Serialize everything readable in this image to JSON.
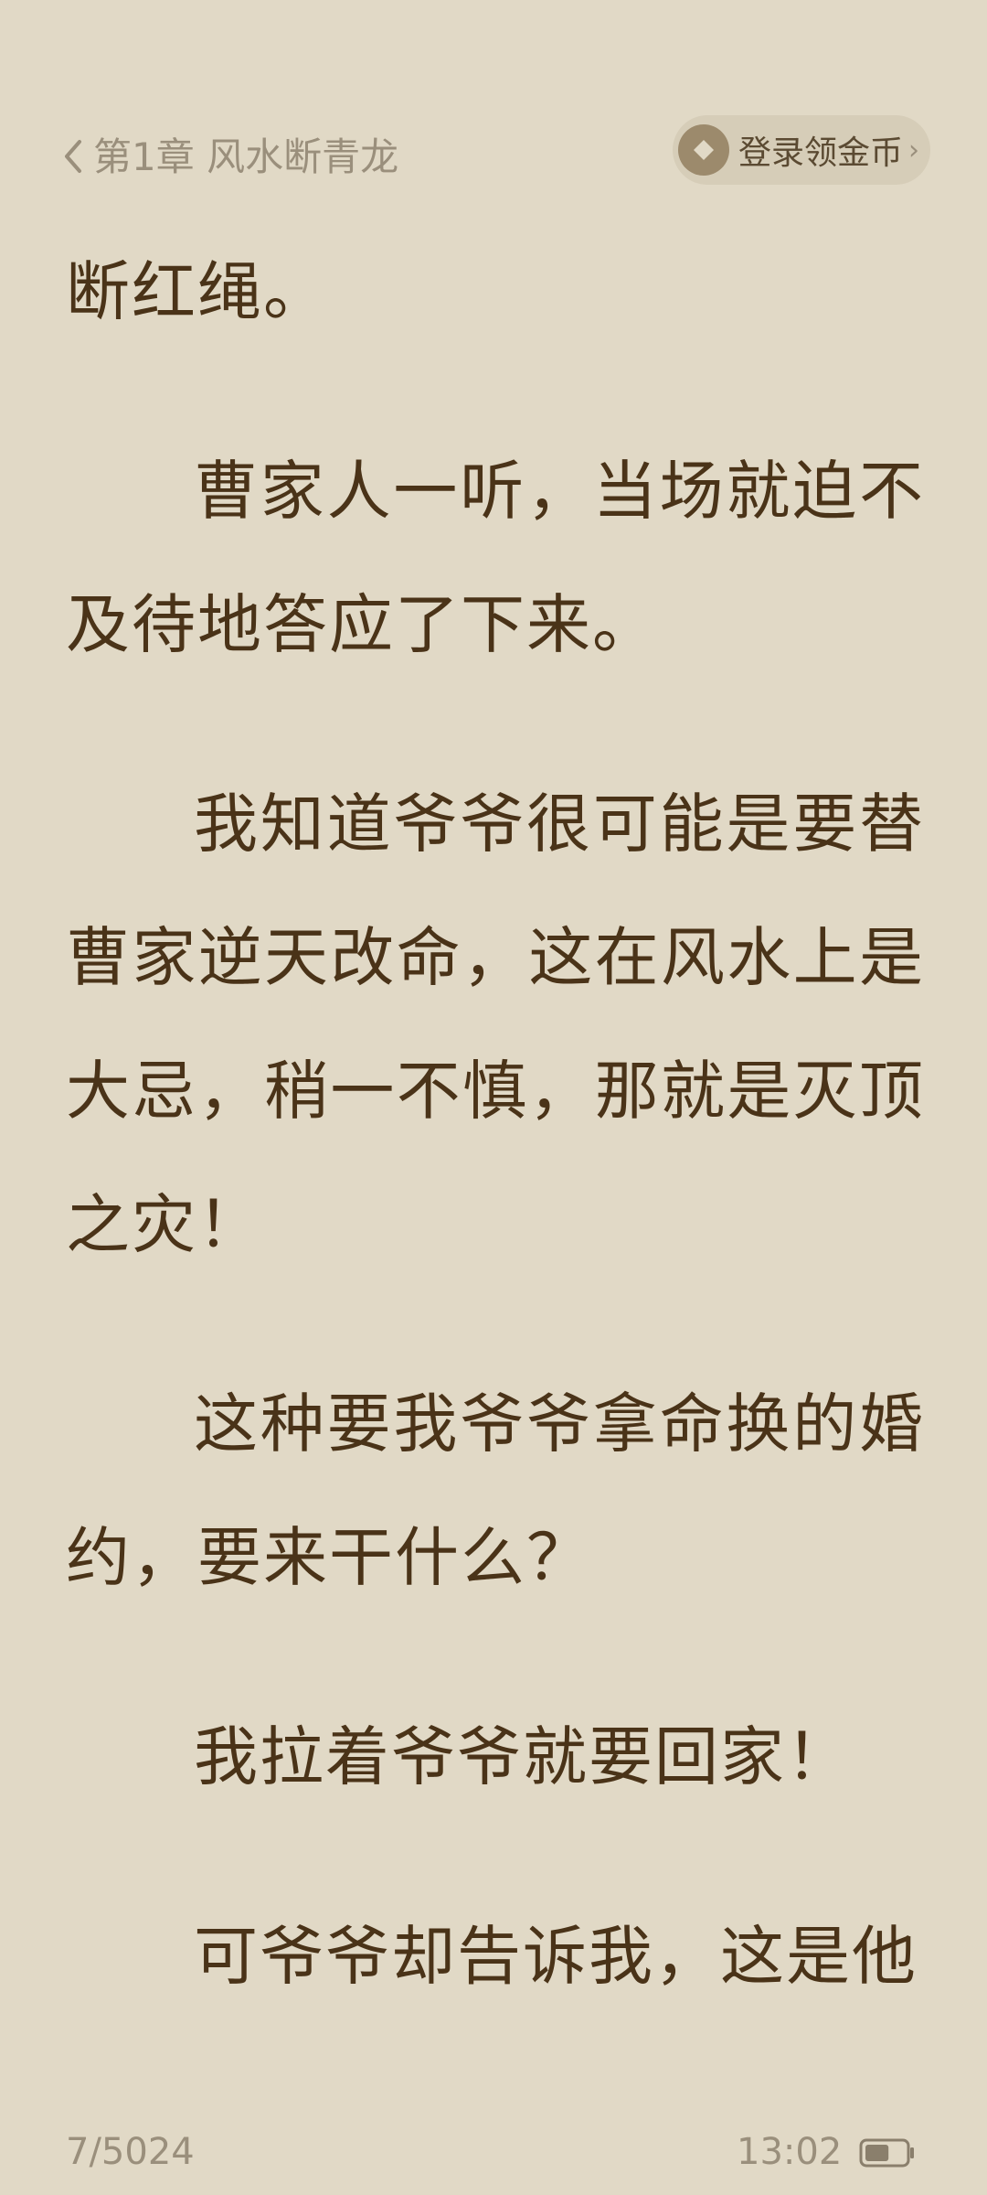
{
  "header": {
    "back_icon": "chevron-left-icon",
    "chapter_title": "第1章 风水断青龙",
    "coin_button": {
      "label": "登录领金币",
      "icon": "coin-icon",
      "chevron": "›"
    }
  },
  "content": {
    "paragraphs": [
      "断红绳。",
      "曹家人一听，当场就迫不及待地答应了下来。",
      "我知道爷爷很可能是要替曹家逆天改命，这在风水上是大忌，稍一不慎，那就是灭顶之灾！",
      "这种要我爷爷拿命换的婚约，要来干什么？",
      "我拉着爷爷就要回家！",
      "可爷爷却告诉我，这是他"
    ]
  },
  "footer": {
    "page_count": "7/5024",
    "clock": "13:02",
    "battery_icon": "battery-icon",
    "battery_level": 0.6
  },
  "colors": {
    "background": "#e1d9c6",
    "text": "#4a3318",
    "muted": "#9a8f7c",
    "pill": "#d6cdb8",
    "coin": "#9c8a6c"
  }
}
